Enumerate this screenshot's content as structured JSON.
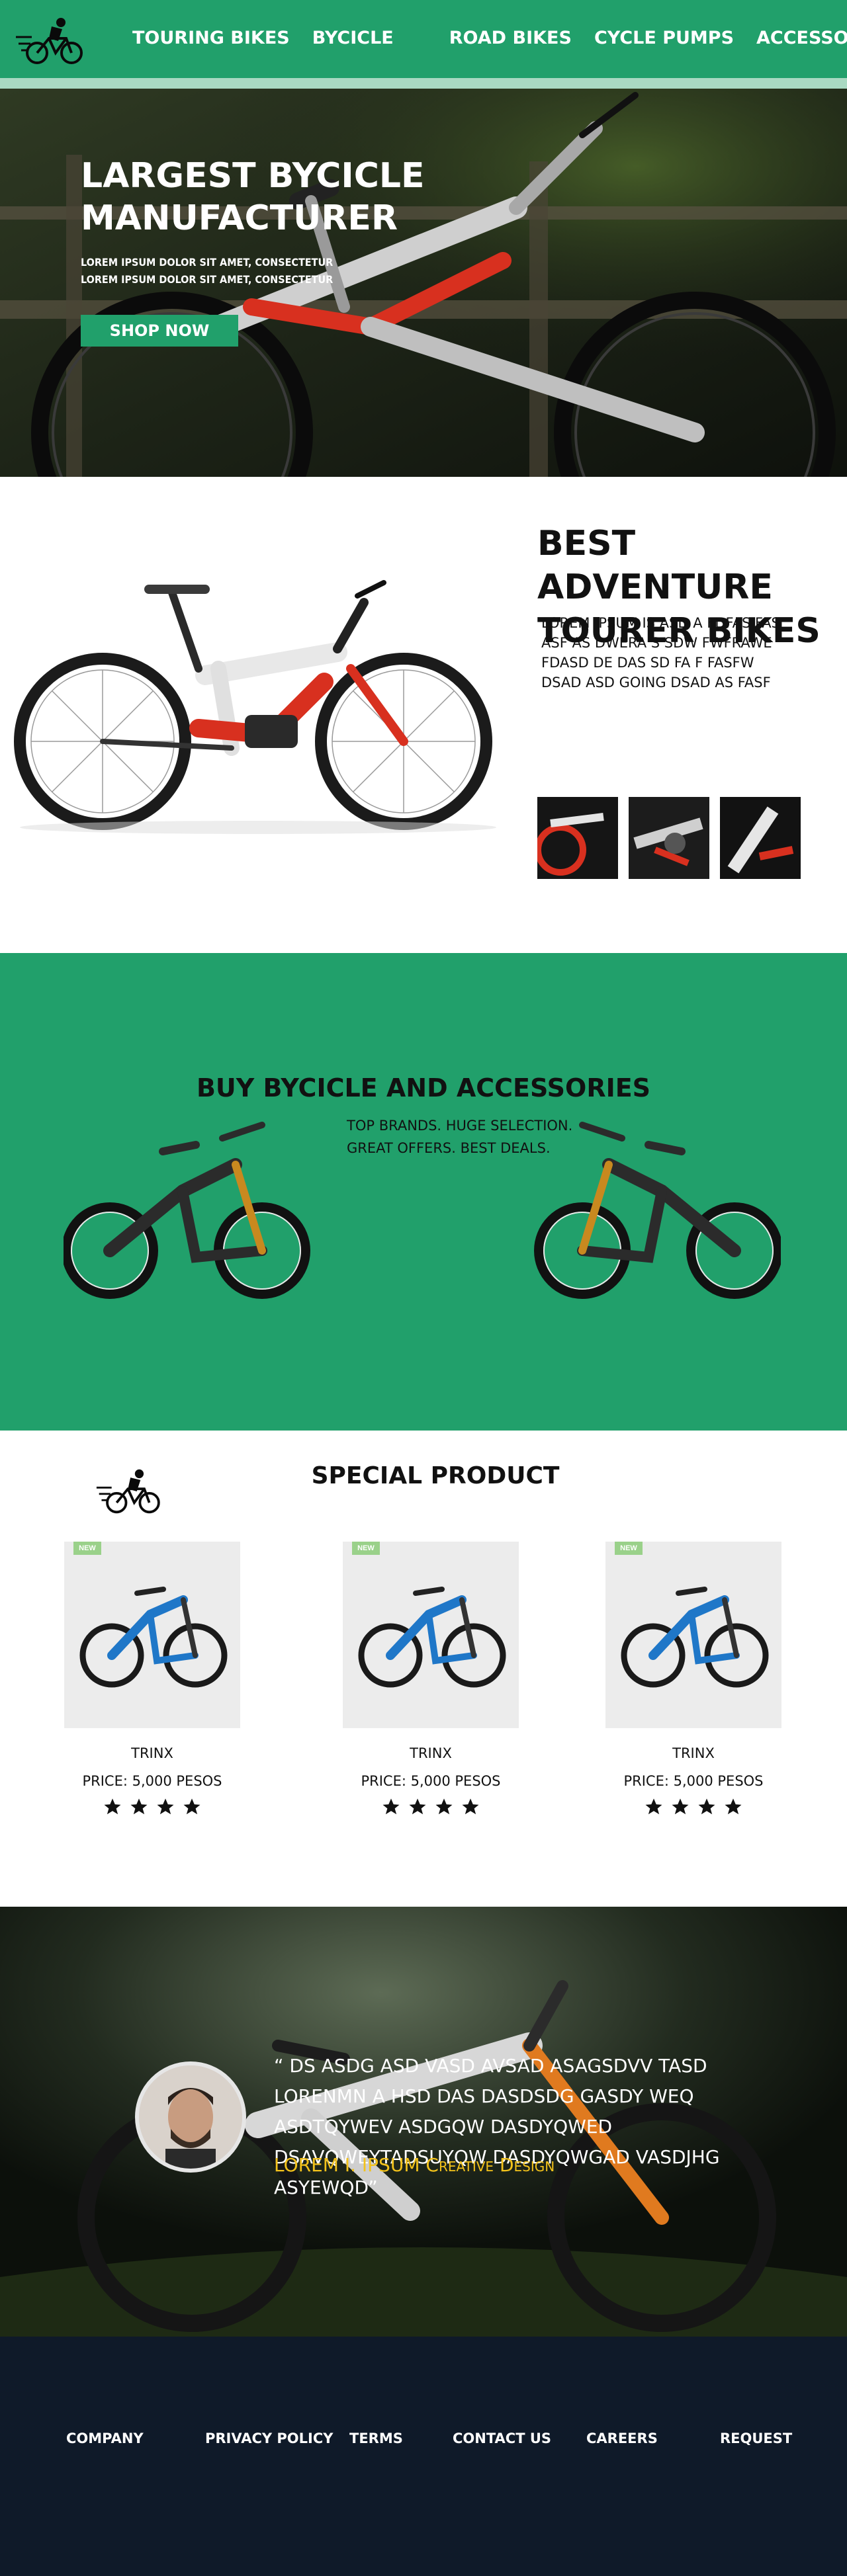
{
  "nav": {
    "links": [
      "TOURING BIKES",
      "BYCICLE",
      "ROAD BIKES",
      "CYCLE PUMPS",
      "ACCESSORIES"
    ]
  },
  "hero": {
    "title": "LARGEST BYCICLE MANUFACTURER",
    "subtitle": "LOREM IPSUM DOLOR SIT AMET, CONSECTETUR LOREM IPSUM DOLOR SIT AMET, CONSECTETUR",
    "cta": "SHOP NOW"
  },
  "tourer": {
    "title": "BEST ADVENTURE TOURER BIKES",
    "text": "LOREM IPSUM IS ASD A FDFAS FAS ASF AS DWERA S SDW FWFRAWE FDASD DE DAS SD FA F FASFW DSAD ASD GOING DSAD AS FASF"
  },
  "buy": {
    "title": "BUY BYCICLE AND ACCESSORIES",
    "subtitle_line1": "TOP BRANDS. HUGE SELECTION.",
    "subtitle_line2": "GREAT OFFERS. BEST DEALS."
  },
  "special": {
    "title": "SPECIAL PRODUCT",
    "products": [
      {
        "badge": "NEW",
        "name": "TRINX",
        "price": "PRICE: 5,000 PESOS",
        "rating": 4
      },
      {
        "badge": "NEW",
        "name": "TRINX",
        "price": "PRICE: 5,000 PESOS",
        "rating": 4
      },
      {
        "badge": "NEW",
        "name": "TRINX",
        "price": "PRICE: 5,000 PESOS",
        "rating": 4
      }
    ]
  },
  "testimonial": {
    "quote": "“ DS ASDG ASD VASD AVSAD ASAGSDVV TASD LORENMN A HSD DAS DASDSDG GASDY WEQ ASDTQYWEV ASDGQW DASDYQWED DSAVQWEYTADSUYQW DASDYQWGAD VASDJHG ASYEWQD”",
    "author": "LOREM I. IPSUM",
    "role": "Creative Design"
  },
  "footer": {
    "links": [
      "COMPANY",
      "PRIVACY POLICY",
      "TERMS",
      "CONTACT US",
      "CAREERS",
      "REQUEST"
    ]
  },
  "colors": {
    "brand_green": "#21a06b",
    "footer_navy": "#0f1a29",
    "accent_yellow": "#f3c21b",
    "bike_red": "#d8301f"
  }
}
